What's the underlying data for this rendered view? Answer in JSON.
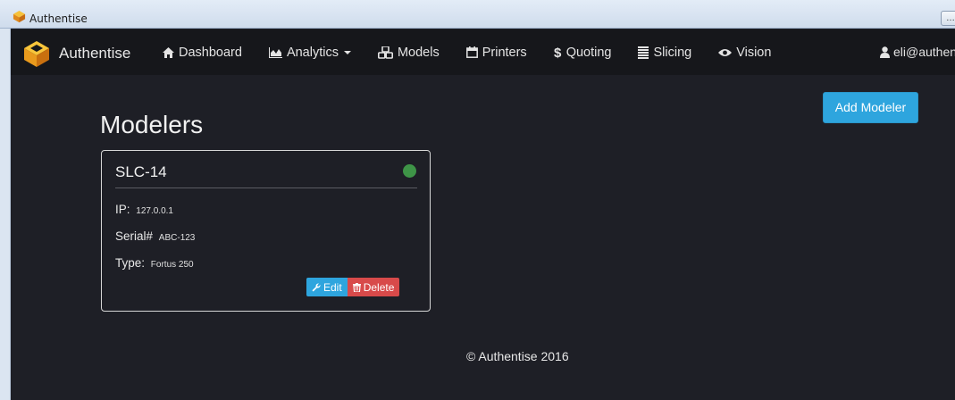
{
  "window": {
    "title": "Authentise",
    "button_label": "…"
  },
  "navbar": {
    "brand": "Authentise",
    "items": [
      {
        "label": "Dashboard",
        "icon": "home-icon"
      },
      {
        "label": "Analytics",
        "icon": "area-chart-icon",
        "dropdown": true
      },
      {
        "label": "Models",
        "icon": "cubes-icon"
      },
      {
        "label": "Printers",
        "icon": "calendar-icon"
      },
      {
        "label": "Quoting",
        "icon": "dollar-icon"
      },
      {
        "label": "Slicing",
        "icon": "layers-icon"
      },
      {
        "label": "Vision",
        "icon": "eye-icon"
      }
    ],
    "user": "eli@authen"
  },
  "main": {
    "title": "Modelers",
    "add_button": "Add Modeler",
    "modelers": [
      {
        "name": "SLC-14",
        "status_color": "#3e9447",
        "ip_label": "IP:",
        "ip": "127.0.0.1",
        "serial_label": "Serial#",
        "serial": "ABC-123",
        "type_label": "Type:",
        "type": "Fortus 250",
        "edit_label": "Edit",
        "delete_label": "Delete"
      }
    ]
  },
  "footer": "© Authentise 2016",
  "colors": {
    "accent": "#2ea5de",
    "danger": "#d84a4a",
    "background": "#1e1f26",
    "navbar": "#16171b"
  }
}
